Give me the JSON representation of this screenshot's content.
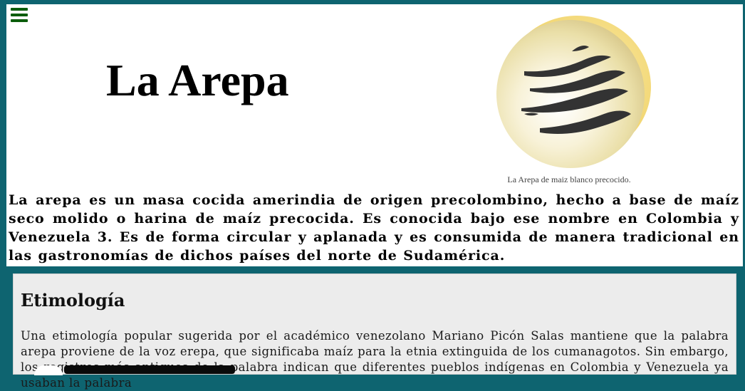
{
  "header": {
    "title": "La Arepa",
    "figure_caption": "La Arepa de maiz blanco precocido.",
    "intro": "La arepa es un masa cocida amerindia de origen precolombino, hecho a base de maíz seco molido o harina de maíz precocida. Es conocida bajo ese nombre en Colombia y Venezuela 3. Es de forma circular y aplanada y es consumida de manera tradicional en las gastronomías de dichos países del norte de Sudamérica."
  },
  "section": {
    "title": "Etimología",
    "body": "Una etimología popular sugerida por el académico venezolano Mariano Picón Salas mantiene que la palabra arepa proviene de la voz erepa, que significaba maíz para la etnia extinguida de los cumanagotos. Sin embargo, los registros más antiguos de la palabra indican que diferentes pueblos indígenas en Colombia y Venezuela ya usaban la palabra"
  },
  "icons": {
    "menu": "hamburger-menu-icon",
    "image": "arepa-image"
  },
  "colors": {
    "background": "#0e6470",
    "menu_icon": "#0b5d0b",
    "content_panel": "#ececec"
  }
}
